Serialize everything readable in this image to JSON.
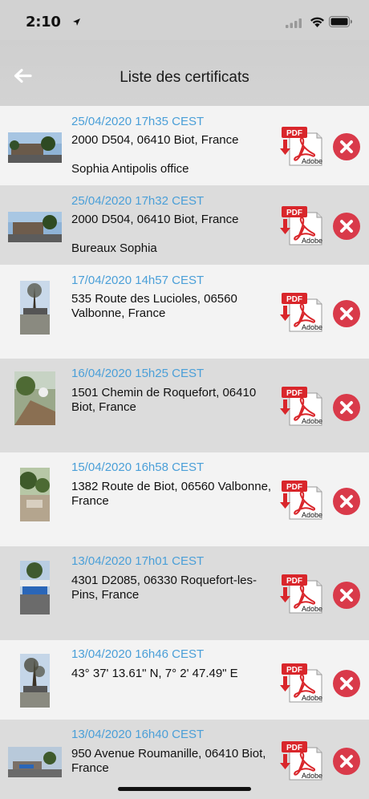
{
  "status_bar": {
    "time": "2:10"
  },
  "nav": {
    "title": "Liste des certificats"
  },
  "pdf_icon": {
    "badge": "PDF",
    "brand": "Adobe"
  },
  "certificates": [
    {
      "date": "25/04/2020 17h35 CEST",
      "address": "2000 D504, 06410 Biot, France",
      "note": "Sophia Antipolis office"
    },
    {
      "date": "25/04/2020 17h32 CEST",
      "address": "2000 D504, 06410 Biot, France",
      "note": "Bureaux Sophia"
    },
    {
      "date": "17/04/2020 14h57 CEST",
      "address": "535 Route des Lucioles, 06560 Valbonne, France",
      "note": ""
    },
    {
      "date": "16/04/2020 15h25 CEST",
      "address": "1501 Chemin de Roquefort, 06410 Biot, France",
      "note": ""
    },
    {
      "date": "15/04/2020 16h58 CEST",
      "address": "1382 Route de Biot, 06560 Valbonne, France",
      "note": ""
    },
    {
      "date": "13/04/2020 17h01 CEST",
      "address": "4301 D2085, 06330 Roquefort-les-Pins, France",
      "note": ""
    },
    {
      "date": "13/04/2020 16h46 CEST",
      "address": "43° 37' 13.61\" N, 7° 2' 47.49\" E",
      "note": ""
    },
    {
      "date": "13/04/2020 16h40 CEST",
      "address": "950 Avenue Roumanille, 06410 Biot, France",
      "note": ""
    }
  ],
  "colors": {
    "date": "#4a9fd8",
    "delete": "#d93a4a",
    "pdf_red": "#d9262b"
  }
}
